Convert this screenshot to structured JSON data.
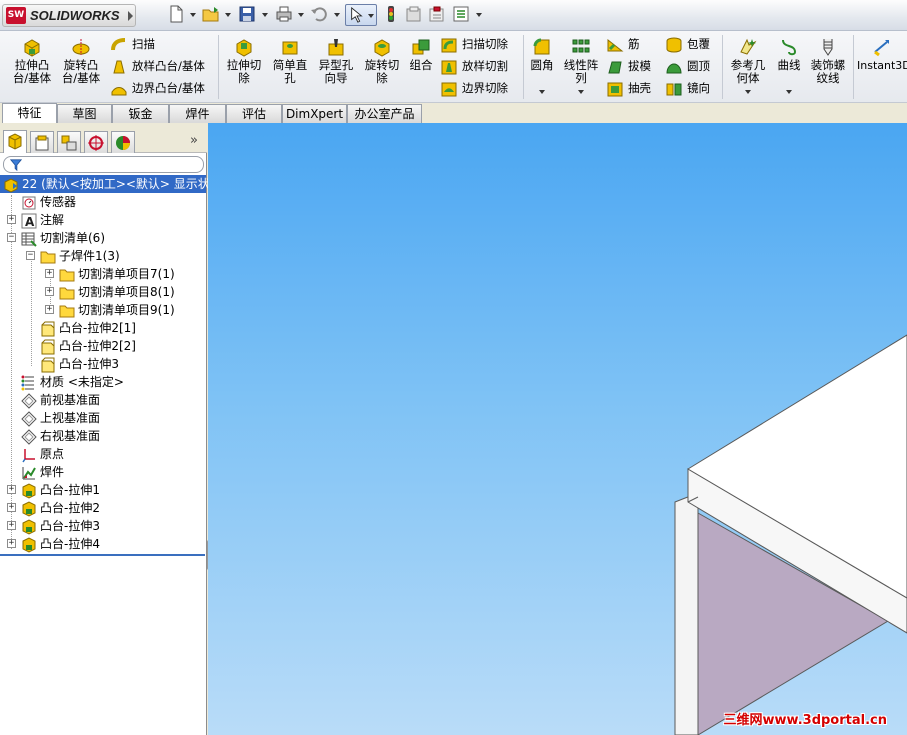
{
  "app": {
    "name": "SOLIDWORKS",
    "logo_badge": "SW"
  },
  "ribbon": {
    "extrude_boss": "拉伸凸\n台/基体",
    "revolve_boss": "旋转凸\n台/基体",
    "sweep": "扫描",
    "loft_boss": "放样凸台/基体",
    "boundary_boss": "边界凸台/基体",
    "extrude_cut": "拉伸切\n除",
    "simple_hole": "简单直\n孔",
    "hole_wizard": "异型孔\n向导",
    "revolve_cut": "旋转切\n除",
    "combine": "组合",
    "swept_cut": "扫描切除",
    "lofted_cut": "放样切割",
    "boundary_cut": "边界切除",
    "fillet": "圆角",
    "linear_pattern": "线性阵\n列",
    "rib": "筋",
    "draft": "拔模",
    "shell": "抽壳",
    "wrap": "包覆",
    "dome": "圆顶",
    "mirror": "镜向",
    "ref_geometry": "参考几\n何体",
    "curves": "曲线",
    "cosmetic_thread": "装饰螺\n纹线",
    "instant3d": "Instant3D"
  },
  "tabs": [
    "特征",
    "草图",
    "钣金",
    "焊件",
    "评估",
    "DimXpert",
    "办公室产品"
  ],
  "tree": {
    "root": "22  (默认<按加工><默认> 显示状",
    "sensors": "传感器",
    "annotations": "注解",
    "cut_list": "切割清单(6)",
    "sub_weldment": "子焊件1(3)",
    "cut_item7": "切割清单项目7(1)",
    "cut_item8": "切割清单项目8(1)",
    "cut_item9": "切割清单项目9(1)",
    "boss_extrude2_1": "凸台-拉伸2[1]",
    "boss_extrude2_2": "凸台-拉伸2[2]",
    "boss_extrude3_body": "凸台-拉伸3",
    "material": "材质 <未指定>",
    "front_plane": "前视基准面",
    "top_plane": "上视基准面",
    "right_plane": "右视基准面",
    "origin": "原点",
    "weldment": "焊件",
    "boss1": "凸台-拉伸1",
    "boss2": "凸台-拉伸2",
    "boss3": "凸台-拉伸3",
    "boss4": "凸台-拉伸4"
  },
  "viewport": {
    "watermark": "三维网www.3dportal.cn"
  },
  "colors": {
    "brand": "#c8102e",
    "selection": "#3169c6",
    "viewport_top": "#4aa6f2",
    "viewport_bottom": "#b9dcf8",
    "model_top": "#ffffff",
    "model_side": "#b9a9c2"
  }
}
